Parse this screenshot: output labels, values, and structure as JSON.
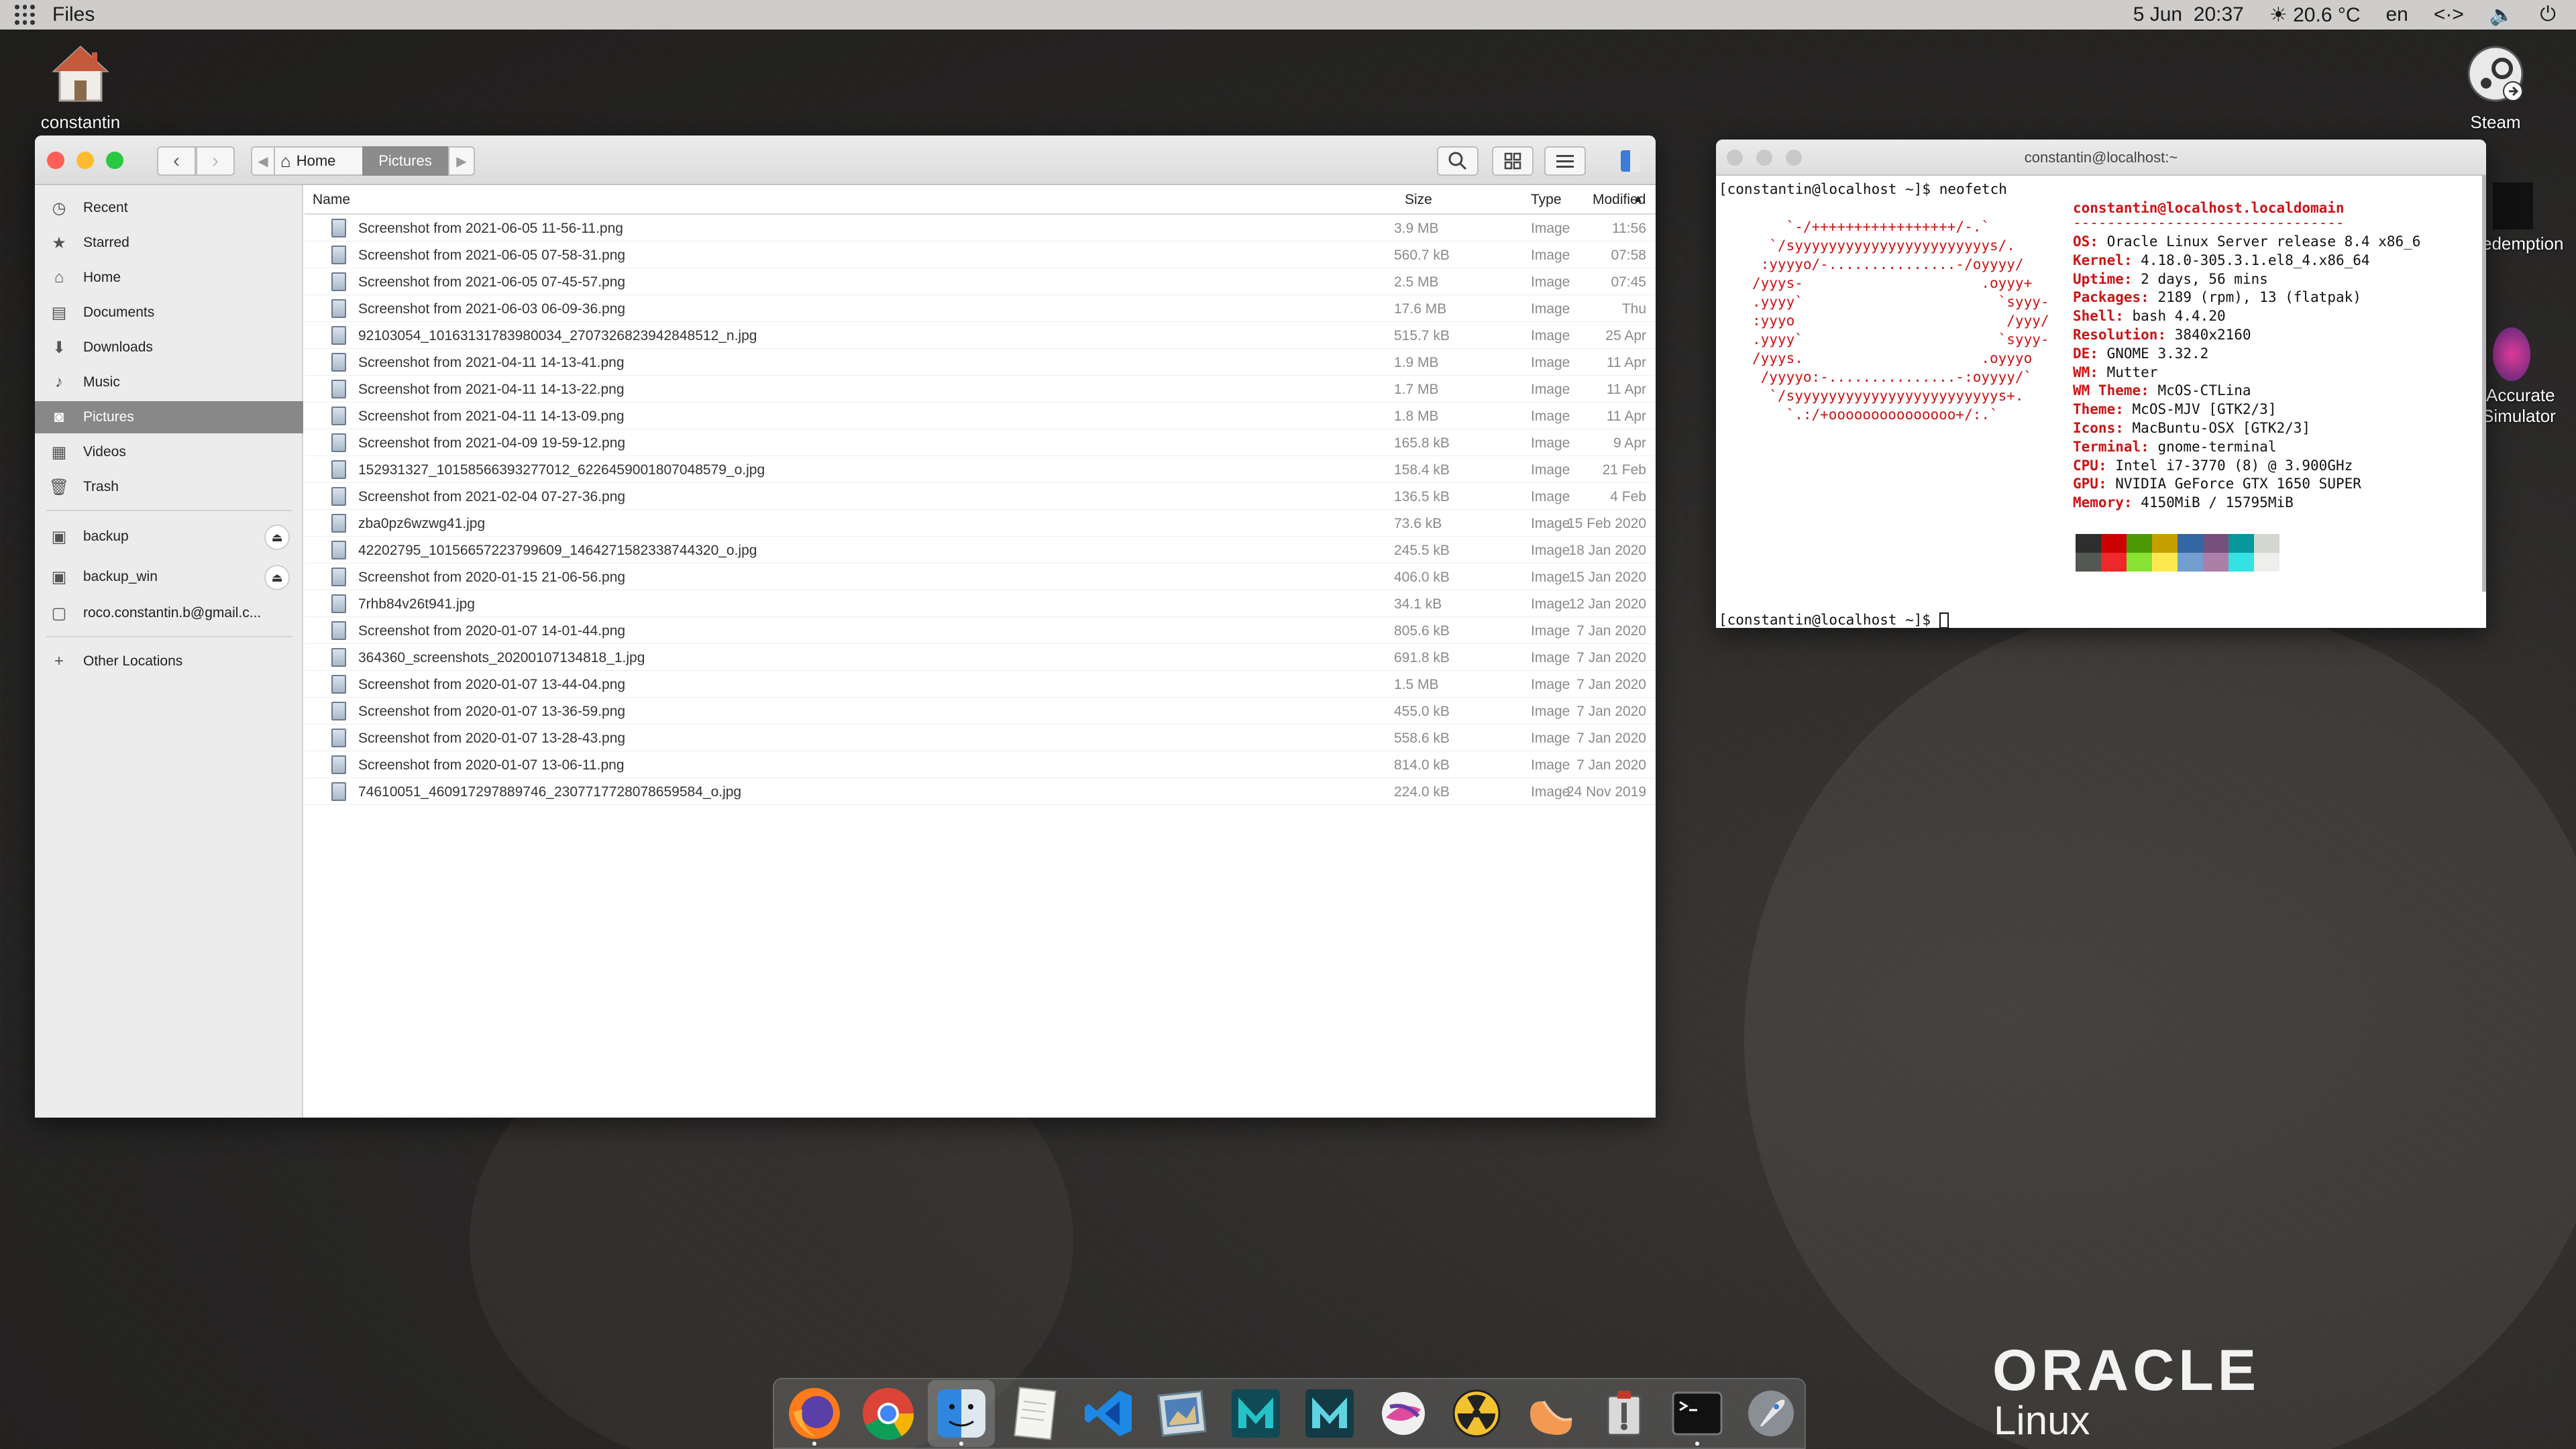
{
  "topbar": {
    "app_name": "Files",
    "date": "5 Jun",
    "time": "20:37",
    "weather": "20.6 °C",
    "lang": "en"
  },
  "desktop": {
    "home_label": "constantin",
    "steam_label": "Steam",
    "redemption_label": "edemption",
    "accurate_label_1": "Accurate",
    "accurate_label_2": "Simulator"
  },
  "files": {
    "breadcrumb": [
      "Home",
      "Pictures"
    ],
    "sidebar": [
      {
        "label": "Recent",
        "icon": "clock-icon"
      },
      {
        "label": "Starred",
        "icon": "star-icon"
      },
      {
        "label": "Home",
        "icon": "home-icon"
      },
      {
        "label": "Documents",
        "icon": "documents-icon"
      },
      {
        "label": "Downloads",
        "icon": "download-icon"
      },
      {
        "label": "Music",
        "icon": "music-icon"
      },
      {
        "label": "Pictures",
        "icon": "camera-icon",
        "active": true
      },
      {
        "label": "Videos",
        "icon": "film-icon"
      },
      {
        "label": "Trash",
        "icon": "trash-icon"
      }
    ],
    "devices": [
      {
        "label": "backup"
      },
      {
        "label": "backup_win"
      },
      {
        "label": "roco.constantin.b@gmail.c..."
      }
    ],
    "other_locations": "Other Locations",
    "columns": {
      "name": "Name",
      "size": "Size",
      "type": "Type",
      "modified": "Modified"
    },
    "rows": [
      {
        "name": "Screenshot from 2021-06-05 11-56-11.png",
        "size": "3.9 MB",
        "type": "Image",
        "modified": "11:56"
      },
      {
        "name": "Screenshot from 2021-06-05 07-58-31.png",
        "size": "560.7 kB",
        "type": "Image",
        "modified": "07:58"
      },
      {
        "name": "Screenshot from 2021-06-05 07-45-57.png",
        "size": "2.5 MB",
        "type": "Image",
        "modified": "07:45"
      },
      {
        "name": "Screenshot from 2021-06-03 06-09-36.png",
        "size": "17.6 MB",
        "type": "Image",
        "modified": "Thu"
      },
      {
        "name": "92103054_10163131783980034_2707326823942848512_n.jpg",
        "size": "515.7 kB",
        "type": "Image",
        "modified": "25 Apr"
      },
      {
        "name": "Screenshot from 2021-04-11 14-13-41.png",
        "size": "1.9 MB",
        "type": "Image",
        "modified": "11 Apr"
      },
      {
        "name": "Screenshot from 2021-04-11 14-13-22.png",
        "size": "1.7 MB",
        "type": "Image",
        "modified": "11 Apr"
      },
      {
        "name": "Screenshot from 2021-04-11 14-13-09.png",
        "size": "1.8 MB",
        "type": "Image",
        "modified": "11 Apr"
      },
      {
        "name": "Screenshot from 2021-04-09 19-59-12.png",
        "size": "165.8 kB",
        "type": "Image",
        "modified": "9 Apr"
      },
      {
        "name": "152931327_10158566393277012_6226459001807048579_o.jpg",
        "size": "158.4 kB",
        "type": "Image",
        "modified": "21 Feb"
      },
      {
        "name": "Screenshot from 2021-02-04 07-27-36.png",
        "size": "136.5 kB",
        "type": "Image",
        "modified": "4 Feb"
      },
      {
        "name": "zba0pz6wzwg41.jpg",
        "size": "73.6 kB",
        "type": "Image",
        "modified": "15 Feb 2020"
      },
      {
        "name": "42202795_10156657223799609_1464271582338744320_o.jpg",
        "size": "245.5 kB",
        "type": "Image",
        "modified": "18 Jan 2020"
      },
      {
        "name": "Screenshot from 2020-01-15 21-06-56.png",
        "size": "406.0 kB",
        "type": "Image",
        "modified": "15 Jan 2020"
      },
      {
        "name": "7rhb84v26t941.jpg",
        "size": "34.1 kB",
        "type": "Image",
        "modified": "12 Jan 2020"
      },
      {
        "name": "Screenshot from 2020-01-07 14-01-44.png",
        "size": "805.6 kB",
        "type": "Image",
        "modified": "7 Jan 2020"
      },
      {
        "name": "364360_screenshots_20200107134818_1.jpg",
        "size": "691.8 kB",
        "type": "Image",
        "modified": "7 Jan 2020"
      },
      {
        "name": "Screenshot from 2020-01-07 13-44-04.png",
        "size": "1.5 MB",
        "type": "Image",
        "modified": "7 Jan 2020"
      },
      {
        "name": "Screenshot from 2020-01-07 13-36-59.png",
        "size": "455.0 kB",
        "type": "Image",
        "modified": "7 Jan 2020"
      },
      {
        "name": "Screenshot from 2020-01-07 13-28-43.png",
        "size": "558.6 kB",
        "type": "Image",
        "modified": "7 Jan 2020"
      },
      {
        "name": "Screenshot from 2020-01-07 13-06-11.png",
        "size": "814.0 kB",
        "type": "Image",
        "modified": "7 Jan 2020"
      },
      {
        "name": "74610051_460917297889746_2307717728078659584_o.jpg",
        "size": "224.0 kB",
        "type": "Image",
        "modified": "24 Nov 2019"
      }
    ]
  },
  "terminal": {
    "title": "constantin@localhost:~",
    "prompt_cmd": "[constantin@localhost ~]$ neofetch",
    "prompt_end": "[constantin@localhost ~]$ ",
    "logo": [
      "    `-/+++++++++++++++++/-.`",
      "  `/syyyyyyyyyyyyyyyyyyyyyyys/.",
      " :yyyyo/-...............-/oyyyy/",
      "/yyys-                     .oyyy+",
      ".yyyy`                       `syyy-",
      ":yyyo                         /yyy/",
      ".yyyy`                       `syyy-",
      "/yyys.                     .oyyyo",
      " /yyyyo:-...............-:oyyyy/`",
      "  `/syyyyyyyyyyyyyyyyyyyyyyyys+.",
      "    `.:/+ooooooooooooooo+/:.`"
    ],
    "user_host": "constantin@localhost.localdomain",
    "separator": "--------------------------------",
    "info": [
      {
        "key": "OS",
        "value": "Oracle Linux Server release 8.4 x86_6"
      },
      {
        "key": "Kernel",
        "value": "4.18.0-305.3.1.el8_4.x86_64"
      },
      {
        "key": "Uptime",
        "value": "2 days, 56 mins"
      },
      {
        "key": "Packages",
        "value": "2189 (rpm), 13 (flatpak)"
      },
      {
        "key": "Shell",
        "value": "bash 4.4.20"
      },
      {
        "key": "Resolution",
        "value": "3840x2160"
      },
      {
        "key": "DE",
        "value": "GNOME 3.32.2"
      },
      {
        "key": "WM",
        "value": "Mutter"
      },
      {
        "key": "WM Theme",
        "value": "McOS-CTLina"
      },
      {
        "key": "Theme",
        "value": "McOS-MJV [GTK2/3]"
      },
      {
        "key": "Icons",
        "value": "MacBuntu-OSX [GTK2/3]"
      },
      {
        "key": "Terminal",
        "value": "gnome-terminal"
      },
      {
        "key": "CPU",
        "value": "Intel i7-3770 (8) @ 3.900GHz"
      },
      {
        "key": "GPU",
        "value": "NVIDIA GeForce GTX 1650 SUPER"
      },
      {
        "key": "Memory",
        "value": "4150MiB / 15795MiB"
      }
    ],
    "palette_top": [
      "#2e2e2e",
      "#cc0000",
      "#4e9a06",
      "#c4a000",
      "#3465a4",
      "#75507b",
      "#06989a",
      "#d3d7cf"
    ],
    "palette_bottom": [
      "#555753",
      "#ef2929",
      "#8ae234",
      "#fce94f",
      "#729fcf",
      "#ad7fa8",
      "#34e2e2",
      "#eeeeec"
    ]
  },
  "dock": [
    "firefox-icon",
    "chrome-icon",
    "finder-icon",
    "text-editor-icon",
    "vscode-icon",
    "preview-icon",
    "maya-icon",
    "mudbox-icon",
    "steam-like-icon",
    "nuclear-icon",
    "orange-icon",
    "archive-utility-icon",
    "terminal-icon",
    "launchpad-icon"
  ],
  "oracle": {
    "brand": "ORACLE",
    "product": "Linux"
  }
}
